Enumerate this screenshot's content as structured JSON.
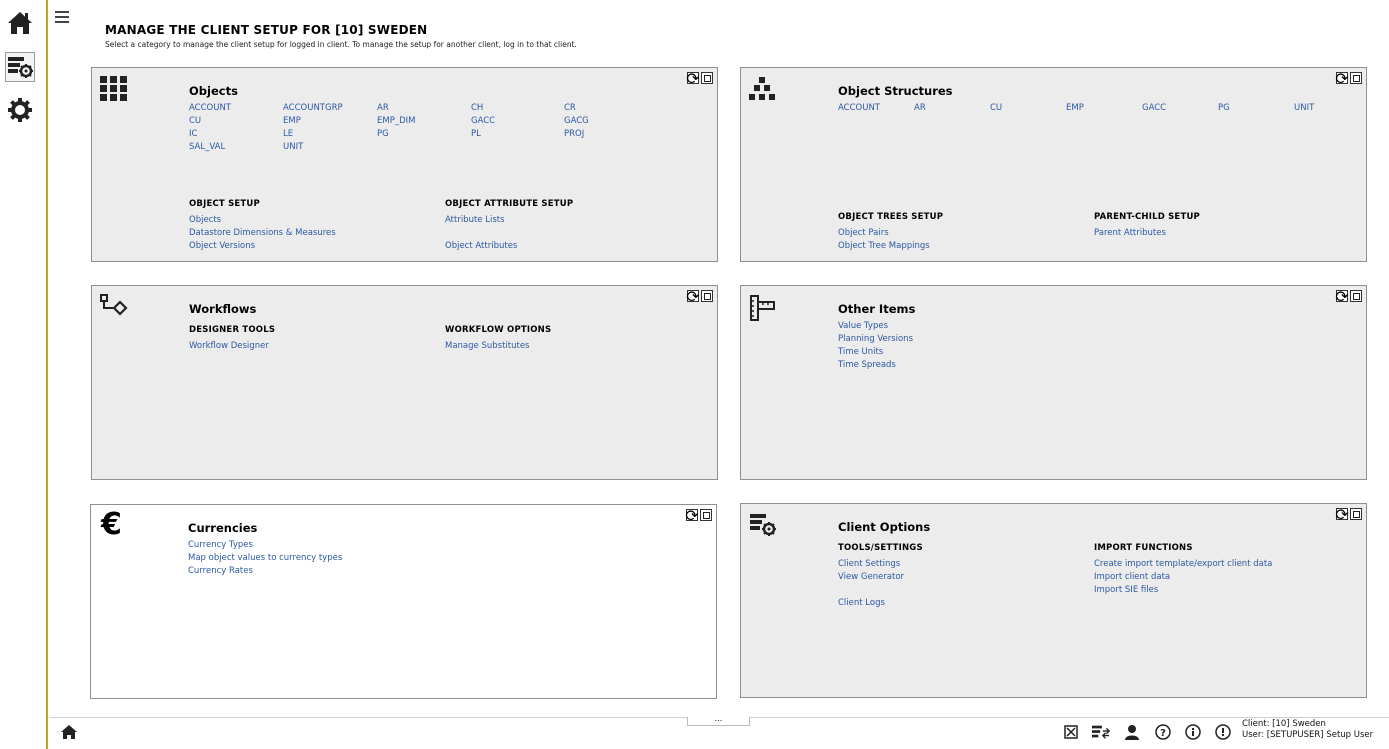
{
  "page": {
    "title": "MANAGE THE CLIENT SETUP FOR [10] SWEDEN",
    "subtitle": "Select a category to manage the client setup for logged in client. To manage the setup for another client, log in to that client."
  },
  "sidebar": {
    "items": [
      {
        "icon": "home-icon"
      },
      {
        "icon": "client-setup-icon"
      },
      {
        "icon": "gear-icon"
      }
    ]
  },
  "cards": {
    "objects": {
      "title": "Objects",
      "links": [
        "ACCOUNT",
        "ACCOUNTGRP",
        "AR",
        "CH",
        "CR",
        "CU",
        "EMP",
        "EMP_DIM",
        "GACC",
        "GACG",
        "IC",
        "LE",
        "PG",
        "PL",
        "PROJ",
        "SAL_VAL",
        "UNIT"
      ],
      "setup_head": "OBJECT SETUP",
      "setup_links": [
        "Objects",
        "Datastore Dimensions & Measures",
        "Object Versions"
      ],
      "attr_head": "OBJECT ATTRIBUTE SETUP",
      "attr_links": [
        "Attribute Lists",
        "Object Attributes"
      ]
    },
    "structures": {
      "title": "Object Structures",
      "links": [
        "ACCOUNT",
        "AR",
        "CU",
        "EMP",
        "GACC",
        "PG",
        "UNIT"
      ],
      "trees_head": "OBJECT TREES SETUP",
      "trees_links": [
        "Object Pairs",
        "Object Tree Mappings"
      ],
      "pc_head": "PARENT-CHILD SETUP",
      "pc_links": [
        "Parent Attributes"
      ]
    },
    "workflows": {
      "title": "Workflows",
      "designer_head": "DESIGNER TOOLS",
      "designer_links": [
        "Workflow Designer"
      ],
      "options_head": "WORKFLOW OPTIONS",
      "options_links": [
        "Manage Substitutes"
      ]
    },
    "other": {
      "title": "Other Items",
      "links": [
        "Value Types",
        "Planning Versions",
        "Time Units",
        "Time Spreads"
      ]
    },
    "currencies": {
      "title": "Currencies",
      "links": [
        "Currency Types",
        "Map object values to currency types",
        "Currency Rates"
      ]
    },
    "client_options": {
      "title": "Client Options",
      "tools_head": "TOOLS/SETTINGS",
      "tools_links": [
        "Client Settings",
        "View Generator",
        "Client Logs"
      ],
      "import_head": "IMPORT FUNCTIONS",
      "import_links": [
        "Create import template/export client data",
        "Import client data",
        "Import SIE files"
      ]
    }
  },
  "bottom": {
    "more": "...",
    "client_line": "Client: [10] Sweden",
    "user_line": "User: [SETUPUSER] Setup User"
  },
  "colors": {
    "accent_border": "#b9a92a",
    "link": "#2c59a4",
    "card_bg": "#ececec"
  }
}
